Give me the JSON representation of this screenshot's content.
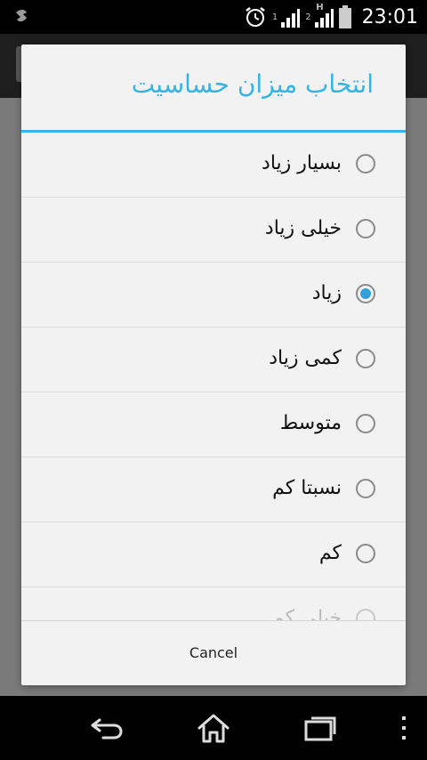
{
  "status_bar": {
    "time": "23:01",
    "sim1_label": "1",
    "sim2_label": "2",
    "sim2_network": "H"
  },
  "dialog": {
    "title": "انتخاب میزان حساسیت",
    "options": [
      {
        "label": "بسیار زیاد",
        "checked": false
      },
      {
        "label": "خیلی زیاد",
        "checked": false
      },
      {
        "label": "زیاد",
        "checked": true
      },
      {
        "label": "کمی زیاد",
        "checked": false
      },
      {
        "label": "متوسط",
        "checked": false
      },
      {
        "label": "نسبتا کم",
        "checked": false
      },
      {
        "label": "کم",
        "checked": false
      },
      {
        "label": "خیلی کم",
        "checked": false
      }
    ],
    "cancel_label": "Cancel"
  },
  "colors": {
    "accent": "#33b5e5",
    "radio_checked": "#33a0d8"
  }
}
